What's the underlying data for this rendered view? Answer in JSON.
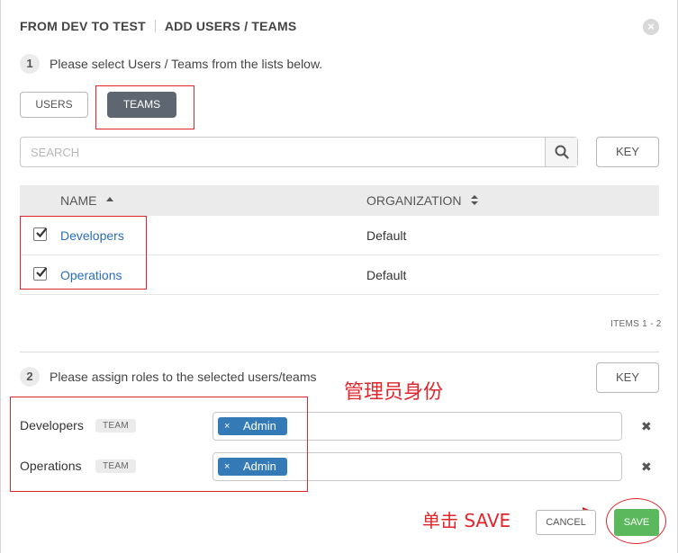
{
  "header": {
    "title_part1": "FROM DEV TO TEST",
    "title_part2": "ADD USERS / TEAMS",
    "close_icon": "close-icon"
  },
  "step1": {
    "number": "1",
    "text": "Please select Users / Teams from the lists below."
  },
  "tabs": [
    {
      "label": "USERS",
      "active": false
    },
    {
      "label": "TEAMS",
      "active": true
    }
  ],
  "search": {
    "placeholder": "SEARCH",
    "value": "",
    "key_label": "KEY"
  },
  "table": {
    "columns": [
      {
        "label": "NAME",
        "sort": "ascending"
      },
      {
        "label": "ORGANIZATION",
        "sort": "sortable"
      }
    ],
    "rows": [
      {
        "name": "Developers",
        "organization": "Default",
        "checked": true
      },
      {
        "name": "Operations",
        "organization": "Default",
        "checked": true
      }
    ],
    "items_label": "ITEMS  1 - 2"
  },
  "step2": {
    "number": "2",
    "text": "Please assign roles to the selected users/teams",
    "key_label": "KEY"
  },
  "roles": [
    {
      "name": "Developers",
      "badge": "TEAM",
      "chip": "Admin",
      "chip_remove": "×",
      "row_remove": "✖"
    },
    {
      "name": "Operations",
      "badge": "TEAM",
      "chip": "Admin",
      "chip_remove": "×",
      "row_remove": "✖"
    }
  ],
  "annotations": {
    "role_note": "管理员身份",
    "save_note": "单击 SAVE",
    "color": "#e0262b"
  },
  "footer": {
    "cancel_label": "CANCEL",
    "save_label": "SAVE"
  },
  "colors": {
    "active_tab": "#5e6771",
    "link": "#2a6ebb",
    "chip": "#337ab7",
    "save": "#5cb85c"
  }
}
